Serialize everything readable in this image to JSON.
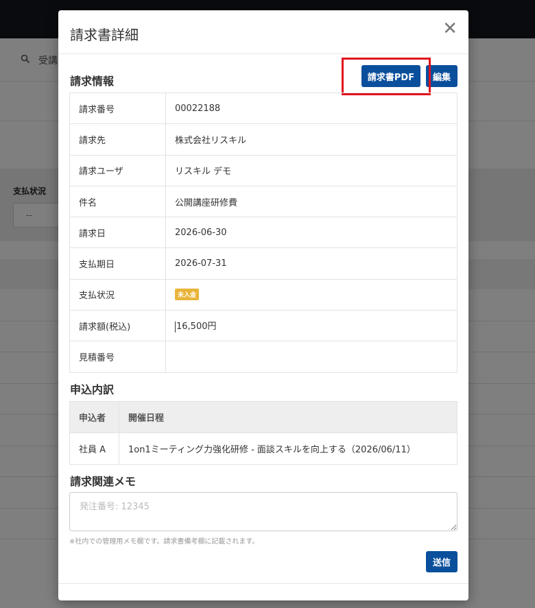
{
  "background": {
    "search_placeholder": "受講",
    "filter_label": "支払状況",
    "filter_value": "--"
  },
  "modal": {
    "title": "請求書詳細",
    "close_icon": "close-icon",
    "billing_section_title": "請求情報",
    "pdf_button_label": "請求書PDF",
    "edit_button_label": "編集",
    "billing_info": [
      {
        "label": "請求番号",
        "value": "00022188"
      },
      {
        "label": "請求先",
        "value": "株式会社リスキル"
      },
      {
        "label": "請求ユーザ",
        "value": "リスキル デモ"
      },
      {
        "label": "件名",
        "value": "公開講座研修費"
      },
      {
        "label": "請求日",
        "value": "2026-06-30"
      },
      {
        "label": "支払期日",
        "value": "2026-07-31"
      },
      {
        "label": "支払状況",
        "badge": "未入金"
      },
      {
        "label": "請求額(税込)",
        "value": "16,500円"
      },
      {
        "label": "見積番号",
        "value": ""
      }
    ],
    "breakdown_section_title": "申込内訳",
    "breakdown_headers": [
      "申込者",
      "開催日程"
    ],
    "breakdown_rows": [
      {
        "applicant": "社員 A",
        "schedule": "1on1ミーティング力強化研修 - 面談スキルを向上する（2026/06/11）"
      }
    ],
    "memo_section_title": "請求関連メモ",
    "memo_placeholder": "発注番号: 12345",
    "memo_help": "※社内での管理用メモ欄です。請求書備考欄に記載されます。",
    "submit_button_label": "送信"
  },
  "colors": {
    "primary": "#0a4f9c",
    "highlight": "#e0121d",
    "badge": "#e8b43a"
  }
}
